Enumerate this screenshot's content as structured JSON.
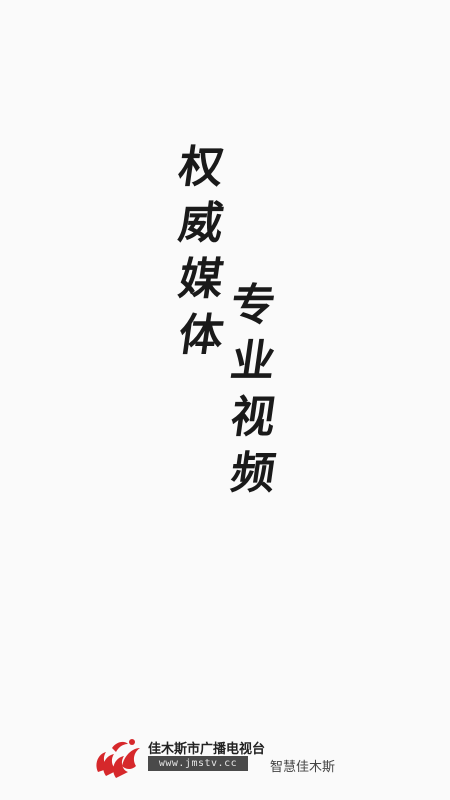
{
  "slogan": {
    "left_column": [
      "权",
      "威",
      "媒",
      "体"
    ],
    "right_column": [
      "专",
      "业",
      "视",
      "频"
    ]
  },
  "footer": {
    "station_name": "佳木斯市广播电视台",
    "website": "www.jmstv.cc",
    "tagline": "智慧佳木斯"
  },
  "colors": {
    "background": "#fafafa",
    "text": "#1a1a1a",
    "logo_red": "#d6282b",
    "url_bar": "#4a4a4a"
  }
}
